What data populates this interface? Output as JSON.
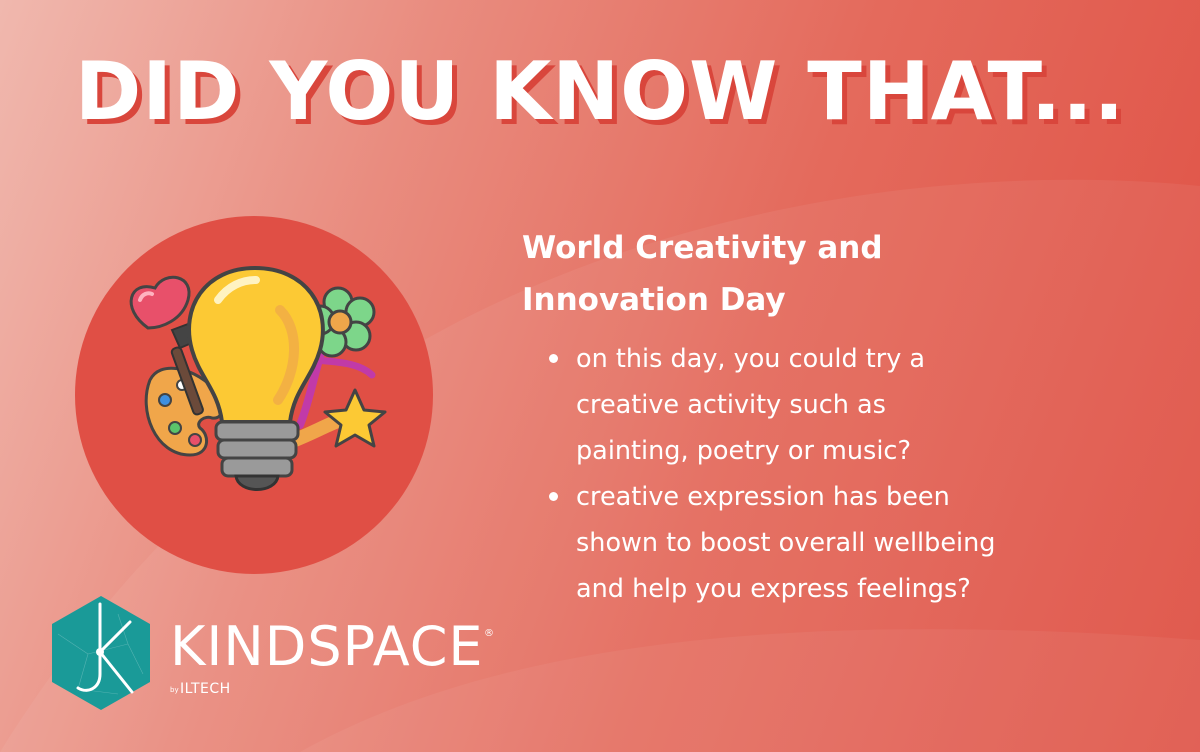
{
  "headline": "DID YOU KNOW THAT...",
  "heading": {
    "line1": "World Creativity and",
    "line2": "Innovation Day"
  },
  "bullets": [
    {
      "line1": "on this day, you could try a",
      "line2": "creative activity such as",
      "line3": "painting, poetry or music?"
    },
    {
      "line1": "creative expression has been",
      "line2": "shown to boost overall wellbeing",
      "line3": "and help you express feelings?"
    }
  ],
  "logo": {
    "wordmark": "KINDSPACE",
    "registered": "®",
    "by": "by",
    "subbrand": "ILTECH"
  },
  "colors": {
    "background_light": "#f0b8ae",
    "background_dark": "#df4f43",
    "circle": "#e04f45",
    "text": "#ffffff",
    "headline_shadow": "#d9463c",
    "logo_teal": "#1a9a98",
    "bulb_yellow": "#fcc934"
  },
  "icons": [
    "lightbulb-icon",
    "heart-icon",
    "paintbrush-icon",
    "palette-icon",
    "flower-icon",
    "star-icon"
  ]
}
